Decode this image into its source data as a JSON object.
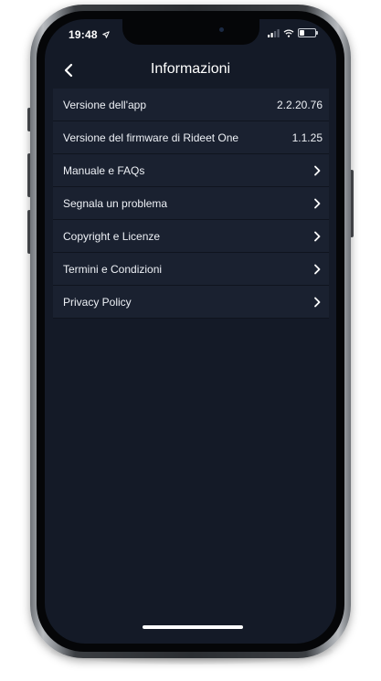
{
  "status_bar": {
    "time": "19:48",
    "location_icon": "location-arrow-icon",
    "signal_icon": "cellular-signal-icon",
    "wifi_icon": "wifi-icon",
    "battery_icon": "battery-icon"
  },
  "nav": {
    "back_icon": "chevron-left-icon",
    "title": "Informazioni"
  },
  "list": {
    "items": [
      {
        "label": "Versione dell'app",
        "value": "2.2.20.76"
      },
      {
        "label": "Versione del firmware di Rideet One",
        "value": "1.1.25"
      },
      {
        "label": "Manuale e FAQs",
        "icon": "chevron-right-icon"
      },
      {
        "label": "Segnala un problema",
        "icon": "chevron-right-icon"
      },
      {
        "label": "Copyright e Licenze",
        "icon": "chevron-right-icon"
      },
      {
        "label": "Termini e Condizioni",
        "icon": "chevron-right-icon"
      },
      {
        "label": "Privacy Policy",
        "icon": "chevron-right-icon"
      }
    ]
  },
  "colors": {
    "screen_background": "#141a27",
    "row_background": "#1a2130",
    "text": "#eef1f6"
  }
}
